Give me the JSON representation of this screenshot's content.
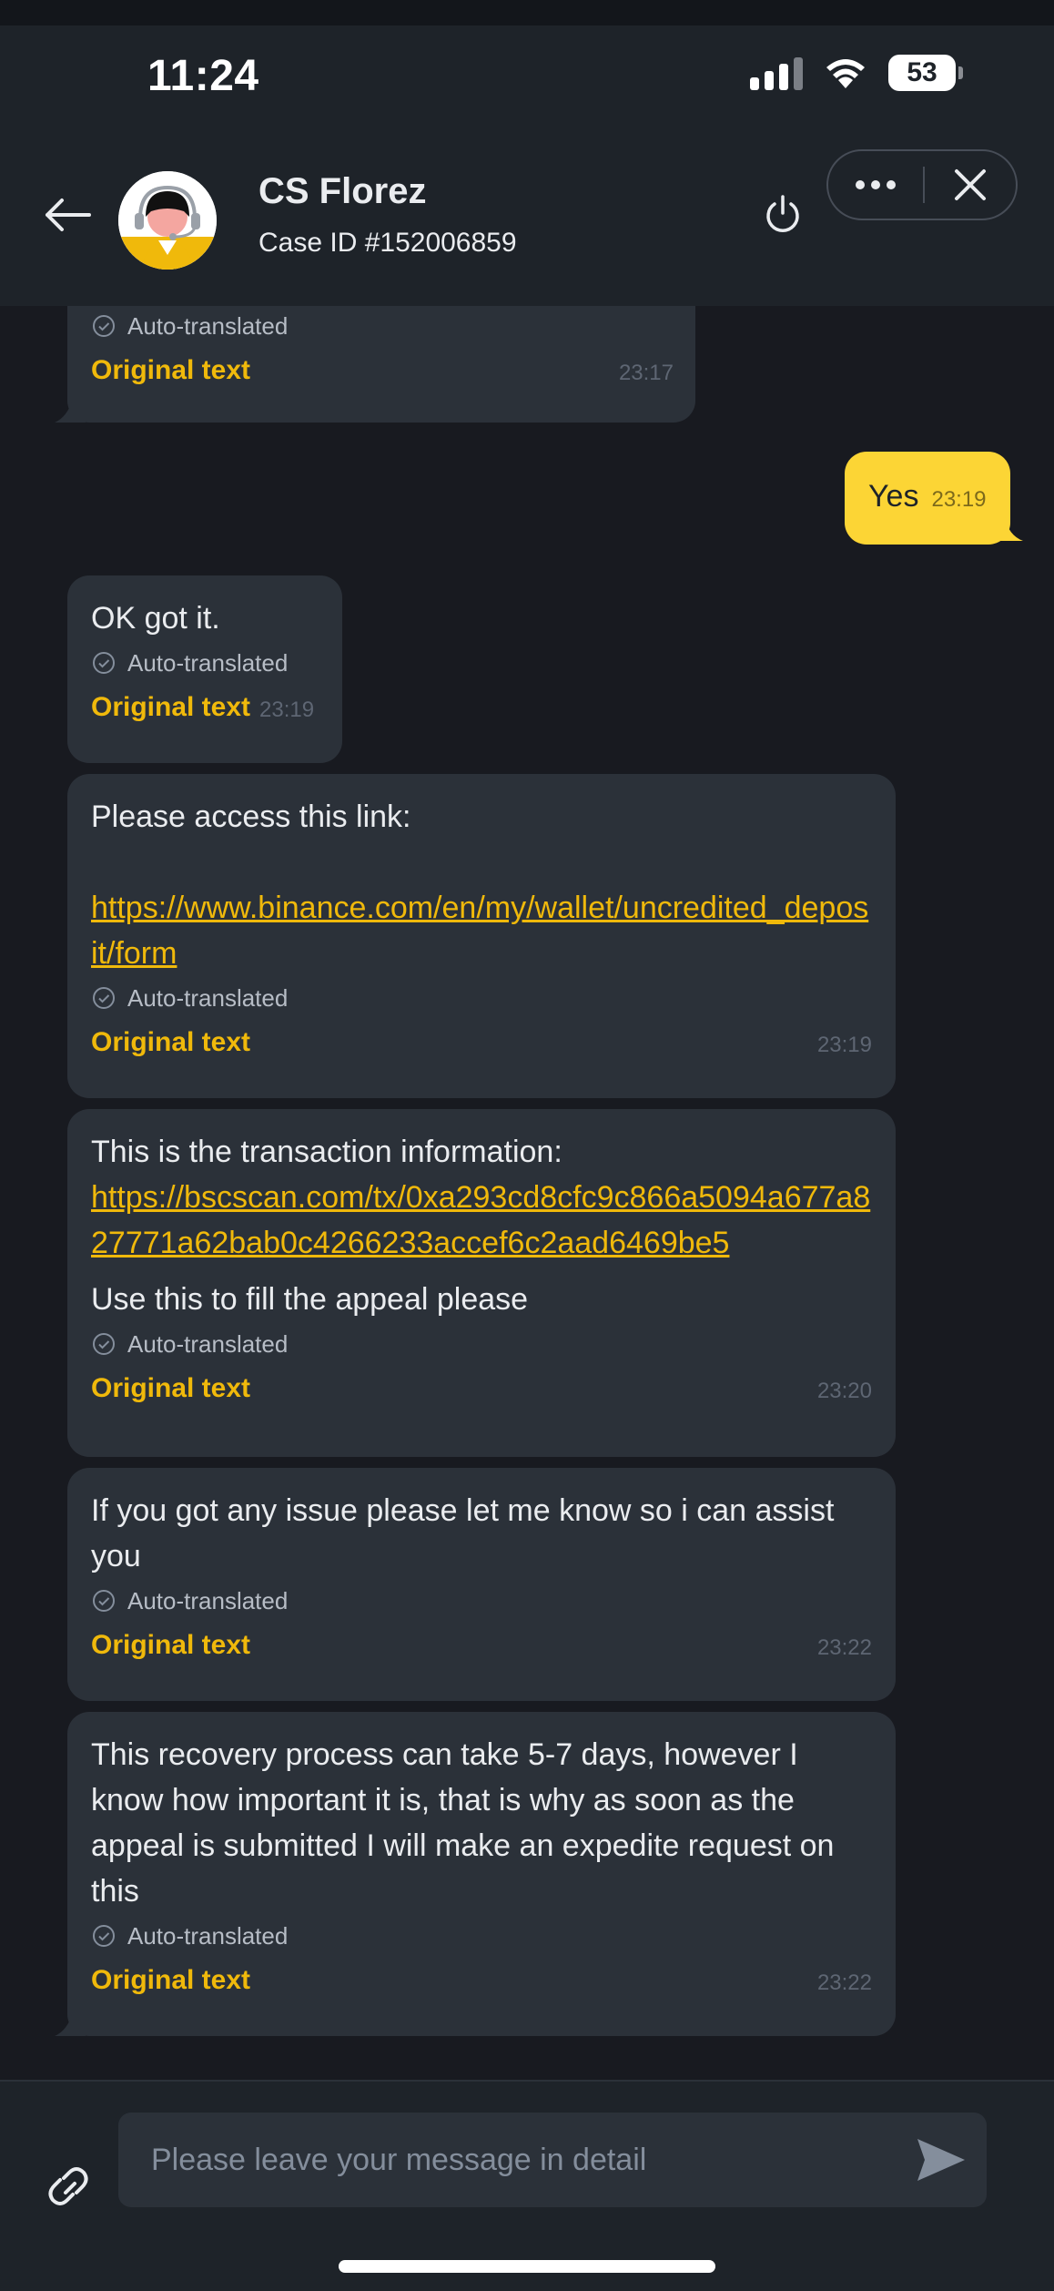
{
  "status_bar": {
    "time": "11:24",
    "battery": "53"
  },
  "header": {
    "agent_name": "CS Florez",
    "case_id": "Case ID #152006859"
  },
  "chat": {
    "auto_translated_label": "Auto-translated",
    "original_text_label": "Original text",
    "messages": [
      {
        "from": "agent",
        "text": "",
        "time": "23:17"
      },
      {
        "from": "user",
        "text": "Yes",
        "time": "23:19"
      },
      {
        "from": "agent",
        "text": "OK got it.",
        "time": "23:19"
      },
      {
        "from": "agent",
        "text": "Please access this link:",
        "link": "https://www.binance.com/en/my/wallet/uncredited_deposit/form",
        "time": "23:19"
      },
      {
        "from": "agent",
        "text": "This is the transaction information:",
        "link": "https://bscscan.com/tx/0xa293cd8cfc9c866a5094a677a827771a62bab0c4266233accef6c2aad6469be5",
        "text_after": "Use this to fill the appeal please",
        "time": "23:20"
      },
      {
        "from": "agent",
        "text": "If you got any issue please let me know so i can assist you",
        "time": "23:22"
      },
      {
        "from": "agent",
        "text": "This recovery process can take 5-7 days, however I know how important it is, that is why as soon as the appeal is submitted I will make an expedite request on this",
        "time": "23:22"
      }
    ]
  },
  "composer": {
    "placeholder": "Please leave your message in detail"
  },
  "icons": [
    "back-arrow-icon",
    "agent-avatar",
    "power-icon",
    "more-icon",
    "close-icon",
    "check-circle-icon",
    "link-icon",
    "send-icon",
    "wifi-icon",
    "signal-icon",
    "battery-icon"
  ],
  "colors": {
    "accent": "#f0b90b",
    "user_bubble": "#fcd535",
    "agent_bubble": "#2b3139",
    "background": "#181a20",
    "header": "#1e2329"
  }
}
